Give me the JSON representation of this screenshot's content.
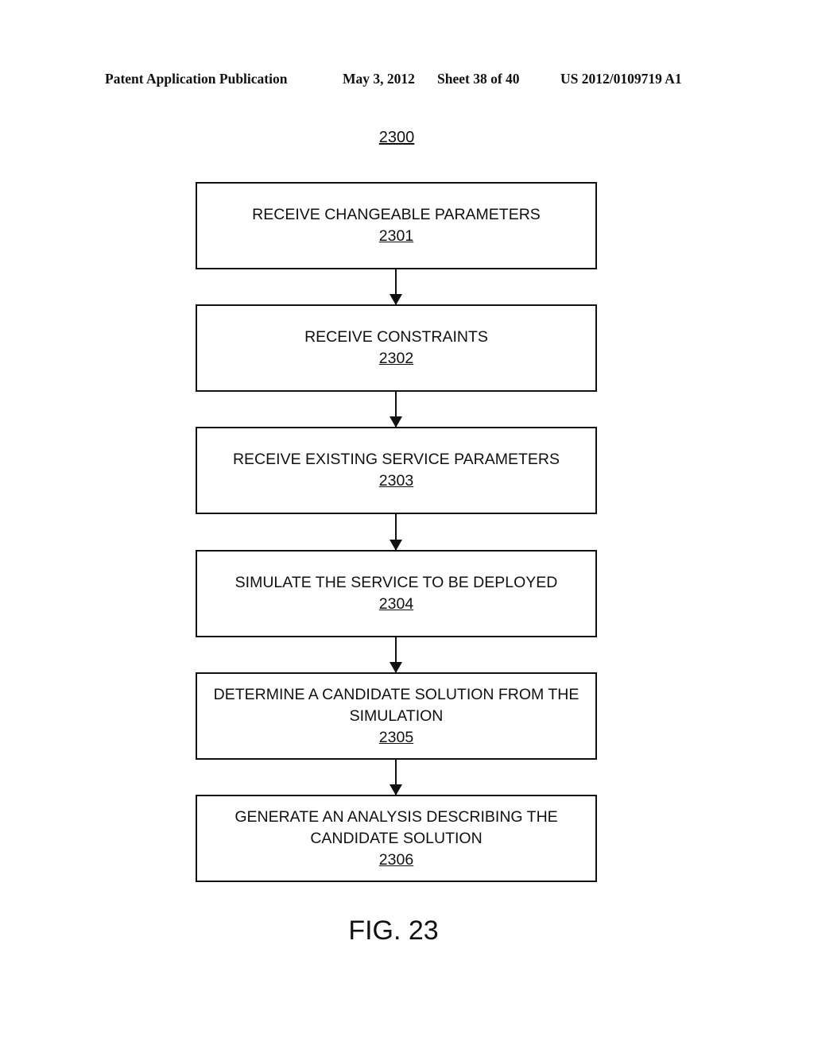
{
  "header": {
    "publication": "Patent Application Publication",
    "date": "May 3, 2012",
    "sheet": "Sheet 38 of 40",
    "number": "US 2012/0109719 A1"
  },
  "diagram": {
    "ref": "2300",
    "steps": [
      {
        "label": "RECEIVE CHANGEABLE PARAMETERS",
        "ref": "2301"
      },
      {
        "label": "RECEIVE CONSTRAINTS",
        "ref": "2302"
      },
      {
        "label": "RECEIVE EXISTING SERVICE PARAMETERS",
        "ref": "2303"
      },
      {
        "label": "SIMULATE THE SERVICE TO BE DEPLOYED",
        "ref": "2304"
      },
      {
        "label": "DETERMINE A CANDIDATE SOLUTION FROM THE SIMULATION",
        "ref": "2305"
      },
      {
        "label": "GENERATE AN ANALYSIS DESCRIBING THE CANDIDATE SOLUTION",
        "ref": "2306"
      }
    ],
    "figure_label": "FIG. 23"
  }
}
